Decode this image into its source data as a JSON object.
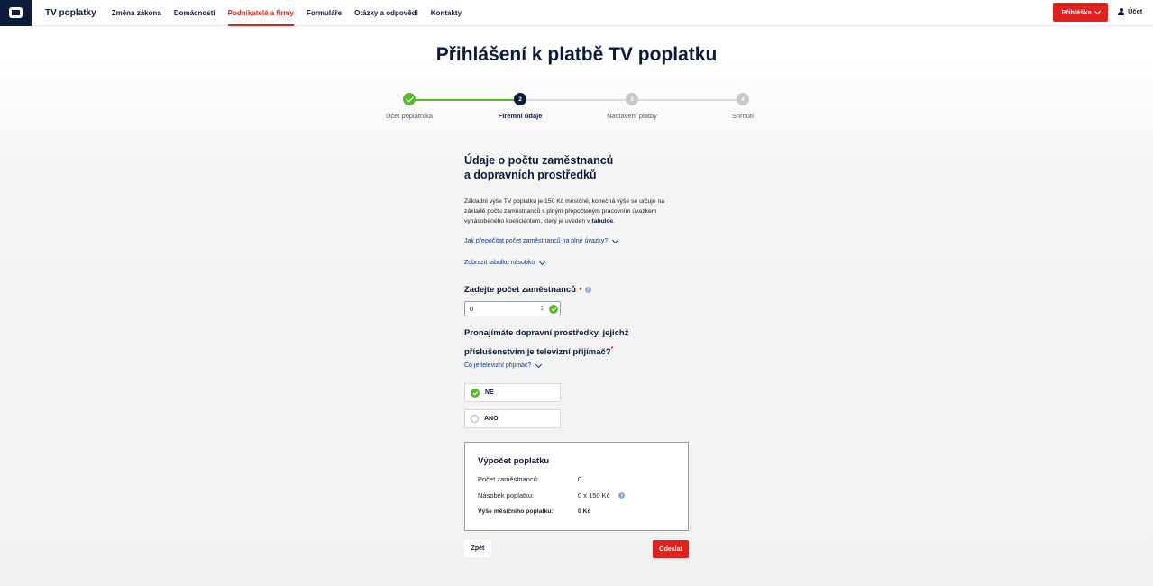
{
  "header": {
    "brand": "TV poplatky",
    "nav": [
      {
        "label": "Změna zákona"
      },
      {
        "label": "Domácnosti"
      },
      {
        "label": "Podnikatelé a firmy",
        "active": true
      },
      {
        "label": "Formuláře"
      },
      {
        "label": "Otázky a odpovědi"
      },
      {
        "label": "Kontakty"
      }
    ],
    "login_label": "Přihláška",
    "account_label": "Účet"
  },
  "page_title": "Přihlášení k platbě TV poplatku",
  "stepper": {
    "steps": [
      {
        "number": "1",
        "label": "Účet poplatníka",
        "state": "done"
      },
      {
        "number": "2",
        "label": "Firemní údaje",
        "state": "current"
      },
      {
        "number": "3",
        "label": "Nastavení platby",
        "state": "todo"
      },
      {
        "number": "4",
        "label": "Shrnutí",
        "state": "todo"
      }
    ]
  },
  "form": {
    "heading_line1": "Údaje o počtu zaměstnanců",
    "heading_line2": "a dopravních prostředků",
    "intro_text": "Základní výše TV poplatku je 150 Kč měsíčně, konečná výše se určuje na základě počtu zaměstnanců s plným přepočteným pracovním úvazkem vynásobeného koeficientem, který je uveden v ",
    "intro_link": "tabulce",
    "intro_end": ".",
    "link_recalc": "Jak přepočítat počet zaměstnanců na plné úvazky?",
    "link_table": "Zobrazit tabulku násobku",
    "employees_label": "Zadejte počet zaměstnanců",
    "required_mark": "*",
    "info_glyph": "i",
    "employees_value": "0",
    "question_line1": "Pronajímáte dopravní prostředky, jejichž",
    "question_line2": "příslušenstvím je televizní přijímač?",
    "link_receiver": "Co je televizní přijímač?",
    "options": [
      {
        "label": "NE",
        "selected": true
      },
      {
        "label": "ANO",
        "selected": false
      }
    ]
  },
  "calculation": {
    "title": "Výpočet poplatku",
    "rows": [
      {
        "label": "Počet zaměstnanců:",
        "value": "0"
      },
      {
        "label": "Násobek poplatku:",
        "value": "0 x 150 Kč"
      },
      {
        "label": "Výše měsíčního poplatku:",
        "value": "0 Kč"
      }
    ]
  },
  "buttons": {
    "back": "Zpět",
    "submit": "Odeslat"
  },
  "colors": {
    "brand_navy": "#0c1a3c",
    "accent_red": "#e2211c",
    "success_green": "#5ab82d"
  }
}
